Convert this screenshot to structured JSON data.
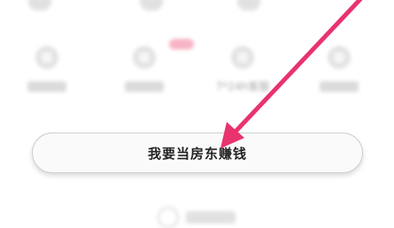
{
  "grid": {
    "items": [
      {
        "label": ""
      },
      {
        "label": ""
      },
      {
        "label": "7*24h客服"
      },
      {
        "label": ""
      }
    ]
  },
  "cta": {
    "label": "我要当房东赚钱"
  },
  "colors": {
    "annotation_arrow": "#e8336e",
    "badge": "#f59ab0",
    "button_border": "#cfcfcf"
  },
  "icons": [
    "shield-icon",
    "rocket-icon",
    "headset-icon",
    "document-icon",
    "app-logo-icon"
  ]
}
